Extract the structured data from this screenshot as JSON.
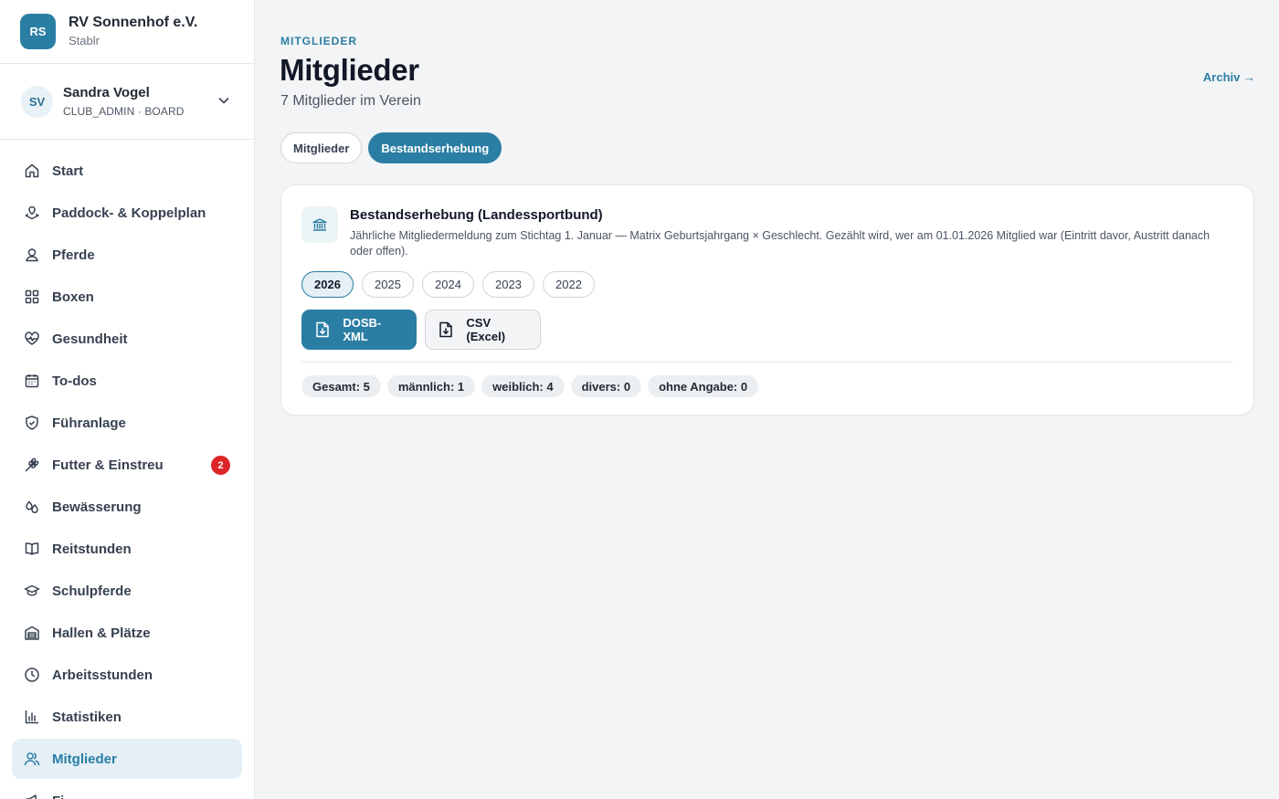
{
  "club": {
    "initials": "RS",
    "name": "RV Sonnenhof e.V.",
    "app": "Stablr"
  },
  "user": {
    "initials": "SV",
    "name": "Sandra Vogel",
    "role": "CLUB_ADMIN · BOARD"
  },
  "nav": [
    {
      "label": "Start",
      "icon": "home-icon"
    },
    {
      "label": "Paddock- & Koppelplan",
      "icon": "map-pin-icon"
    },
    {
      "label": "Pferde",
      "icon": "horse-icon"
    },
    {
      "label": "Boxen",
      "icon": "grid-icon"
    },
    {
      "label": "Gesundheit",
      "icon": "heart-pulse-icon"
    },
    {
      "label": "To-dos",
      "icon": "calendar-icon"
    },
    {
      "label": "Führanlage",
      "icon": "shield-icon"
    },
    {
      "label": "Futter & Einstreu",
      "icon": "wheat-icon",
      "badge": "2"
    },
    {
      "label": "Bewässerung",
      "icon": "droplets-icon"
    },
    {
      "label": "Reitstunden",
      "icon": "book-icon"
    },
    {
      "label": "Schulpferde",
      "icon": "graduation-cap-icon"
    },
    {
      "label": "Hallen & Plätze",
      "icon": "warehouse-icon"
    },
    {
      "label": "Arbeitsstunden",
      "icon": "clock-icon"
    },
    {
      "label": "Statistiken",
      "icon": "bar-chart-icon"
    },
    {
      "label": "Mitglieder",
      "icon": "users-icon",
      "active": true
    },
    {
      "label": "Fi",
      "icon": "megaphone-icon"
    }
  ],
  "header": {
    "eyebrow": "MITGLIEDER",
    "title": "Mitglieder",
    "subtitle": "7 Mitglieder im Verein",
    "archive_link": "Archiv →"
  },
  "tabs": [
    {
      "label": "Mitglieder",
      "active": false
    },
    {
      "label": "Bestandserhebung",
      "active": true
    }
  ],
  "card": {
    "icon": "bank-icon",
    "title": "Bestandserhebung (Landessportbund)",
    "description": "Jährliche Mitgliedermeldung zum Stichtag 1. Januar — Matrix Geburtsjahrgang × Geschlecht. Gezählt wird, wer am 01.01.2026 Mitglied war (Eintritt davor, Austritt danach oder offen).",
    "years": [
      "2026",
      "2025",
      "2024",
      "2023",
      "2022"
    ],
    "selected_year": "2026",
    "buttons": {
      "xml": "DOSB-XML",
      "csv": "CSV (Excel)"
    },
    "stats": [
      "Gesamt: 5",
      "männlich: 1",
      "weiblich: 4",
      "divers: 0",
      "ohne Angabe: 0"
    ]
  },
  "colors": {
    "accent": "#2b7ea3",
    "badge": "#dc2626",
    "active_bg": "#e4eff6"
  }
}
